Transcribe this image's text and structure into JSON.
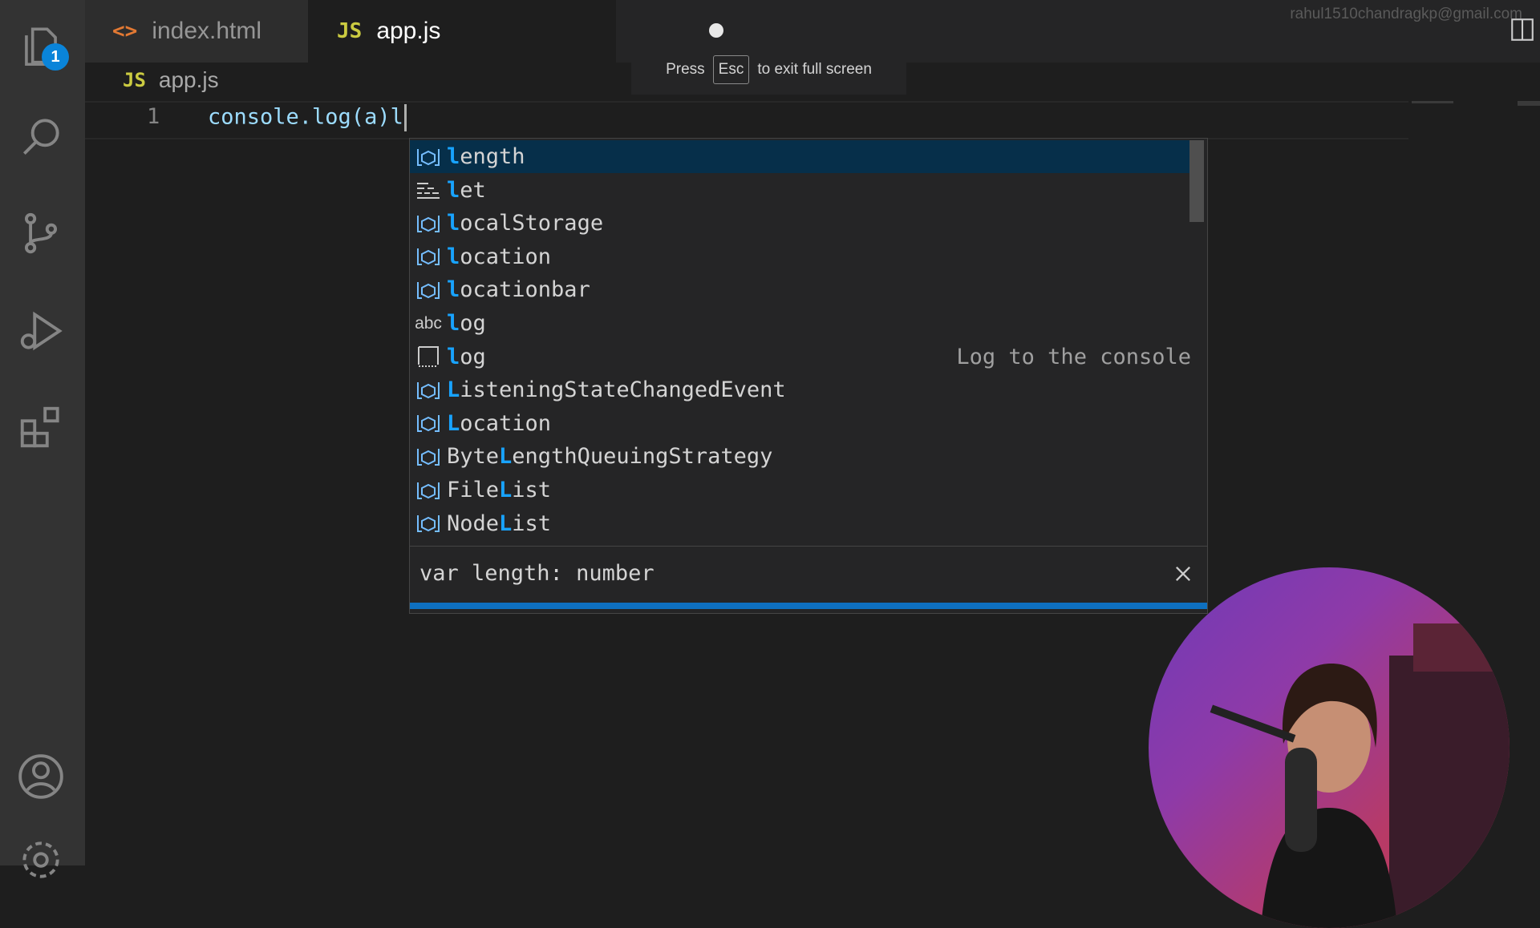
{
  "window": {
    "account_email": "rahul1510chandragkp@gmail.com"
  },
  "activity_bar": {
    "explorer_badge": "1"
  },
  "tabs": [
    {
      "label": "index.html",
      "icon": "<>",
      "active": false
    },
    {
      "label": "app.js",
      "icon": "JS",
      "active": true,
      "modified": true
    }
  ],
  "fullscreen_toast": {
    "before": "Press",
    "key": "Esc",
    "after": "to exit full screen"
  },
  "breadcrumb": {
    "icon": "JS",
    "file": "app.js"
  },
  "editor": {
    "line_number": "1",
    "code": "console.log(a)l"
  },
  "suggestions": {
    "items": [
      {
        "icon": "variable-icon",
        "pre": "",
        "match": "l",
        "rest": "ength",
        "detail": "",
        "selected": true
      },
      {
        "icon": "keyword-icon",
        "pre": "",
        "match": "l",
        "rest": "et",
        "detail": "",
        "selected": false
      },
      {
        "icon": "variable-icon",
        "pre": "",
        "match": "l",
        "rest": "ocalStorage",
        "detail": "",
        "selected": false
      },
      {
        "icon": "variable-icon",
        "pre": "",
        "match": "l",
        "rest": "ocation",
        "detail": "",
        "selected": false
      },
      {
        "icon": "variable-icon",
        "pre": "",
        "match": "l",
        "rest": "ocationbar",
        "detail": "",
        "selected": false
      },
      {
        "icon": "text-icon",
        "pre": "",
        "match": "l",
        "rest": "og",
        "detail": "",
        "selected": false
      },
      {
        "icon": "snippet-icon",
        "pre": "",
        "match": "l",
        "rest": "og",
        "detail": "Log to the console",
        "selected": false
      },
      {
        "icon": "variable-icon",
        "pre": "",
        "match": "L",
        "rest": "isteningStateChangedEvent",
        "detail": "",
        "selected": false
      },
      {
        "icon": "variable-icon",
        "pre": "",
        "match": "L",
        "rest": "ocation",
        "detail": "",
        "selected": false
      },
      {
        "icon": "variable-icon",
        "pre": "Byte",
        "match": "L",
        "rest": "engthQueuingStrategy",
        "detail": "",
        "selected": false
      },
      {
        "icon": "variable-icon",
        "pre": "File",
        "match": "L",
        "rest": "ist",
        "detail": "",
        "selected": false
      },
      {
        "icon": "variable-icon",
        "pre": "Node",
        "match": "L",
        "rest": "ist",
        "detail": "",
        "selected": false
      }
    ],
    "details": "var length: number"
  },
  "colors": {
    "accent": "#0a84d9",
    "match": "#18a3ff",
    "selection": "#062f4a",
    "js_yellow": "#cbcb41",
    "html_orange": "#e37933"
  }
}
